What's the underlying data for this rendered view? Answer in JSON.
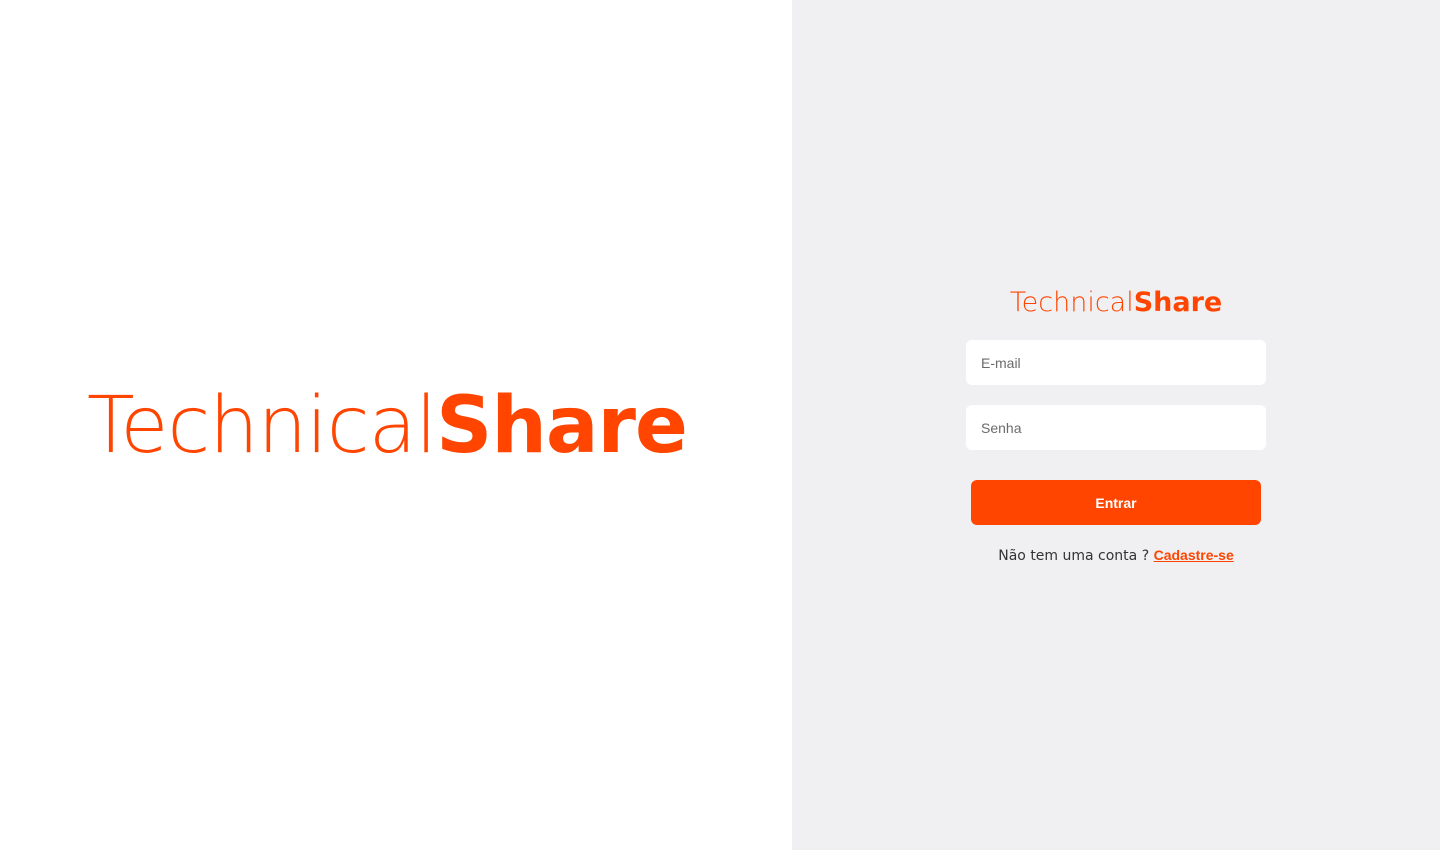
{
  "colors": {
    "accent": "#ff4500",
    "left_background": "#ffffff",
    "right_background": "#f0f0f2",
    "text_dark": "#333333"
  },
  "hero": {
    "logo_light": "Technical",
    "logo_bold": "Share"
  },
  "login_form": {
    "logo_light": "Technical",
    "logo_bold": "Share",
    "email_placeholder": "E-mail",
    "email_value": "",
    "password_placeholder": "Senha",
    "password_value": "",
    "submit_label": "Entrar",
    "signup_prompt": "Não tem uma conta ?",
    "signup_link": "Cadastre-se"
  }
}
